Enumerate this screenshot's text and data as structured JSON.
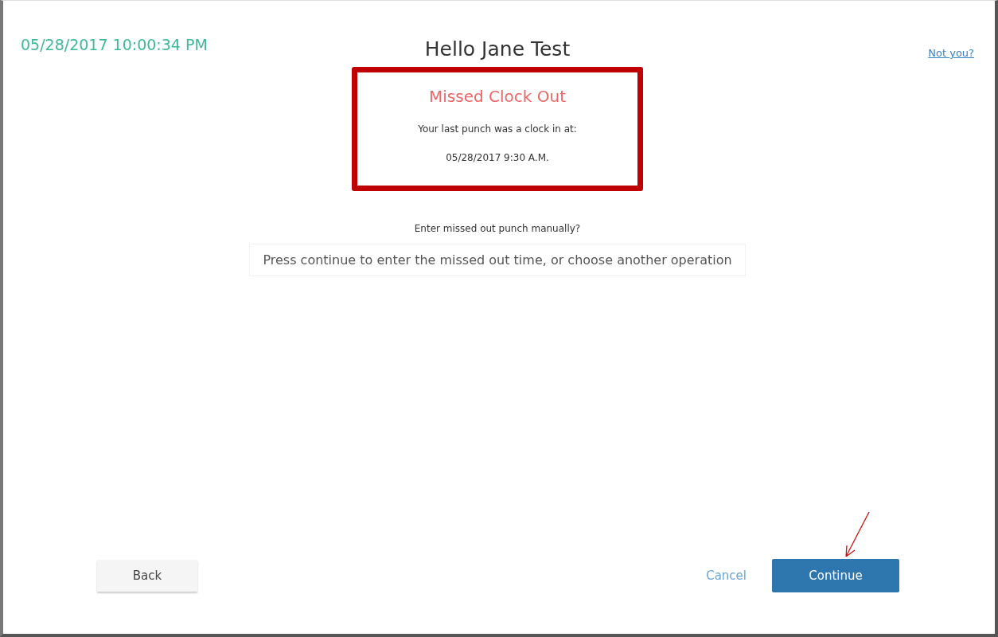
{
  "header": {
    "timestamp": "05/28/2017 10:00:34 PM",
    "title": "Hello Jane Test",
    "not_you_link": "Not you?"
  },
  "alert": {
    "title": "Missed Clock Out",
    "message": "Your last punch was a clock in at:",
    "punch_time": "05/28/2017 9:30 A.M."
  },
  "question": "Enter missed out punch manually?",
  "instruction": "Press continue to enter the missed out time, or choose another operation",
  "buttons": {
    "back": "Back",
    "cancel": "Cancel",
    "continue": "Continue"
  }
}
